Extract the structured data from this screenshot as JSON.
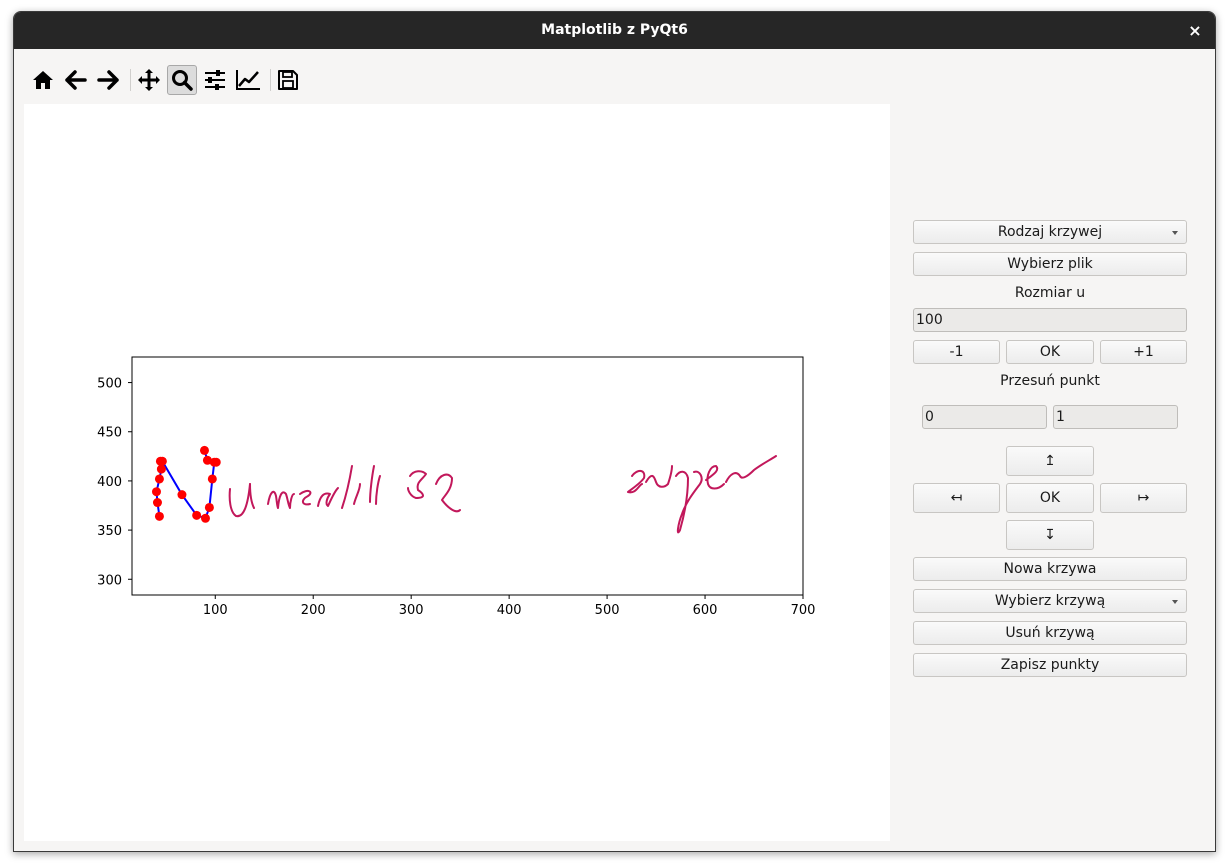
{
  "window": {
    "title": "Matplotlib z PyQt6",
    "close_glyph": "×"
  },
  "toolbar": {
    "items": [
      "home-icon",
      "back-arrow-icon",
      "forward-arrow-icon",
      "pan-icon",
      "zoom-icon",
      "subplots-config-icon",
      "axes-edit-icon",
      "save-icon"
    ],
    "active": "zoom-icon"
  },
  "panel": {
    "curve_type_label": "Rodzaj krzywej",
    "choose_file_label": "Wybierz plik",
    "size_label": "Rozmiar u",
    "size_value": "100",
    "minus_label": "-1",
    "ok_label": "OK",
    "plus_label": "+1",
    "move_point_label": "Przesuń punkt",
    "point_index_value": "0",
    "point_step_value": "1",
    "up_label": "↥",
    "left_label": "↤",
    "ok2_label": "OK",
    "right_label": "↦",
    "down_label": "↧",
    "new_curve_label": "Nowa krzywa",
    "select_curve_label": "Wybierz krzywą",
    "delete_curve_label": "Usuń krzywą",
    "save_points_label": "Zapisz punkty"
  },
  "chart_data": {
    "type": "line",
    "xlim": [
      15,
      700
    ],
    "ylim": [
      284,
      526
    ],
    "xticks": [
      "100",
      "200",
      "300",
      "400",
      "500",
      "600",
      "700"
    ],
    "yticks": [
      "300",
      "350",
      "400",
      "450",
      "500"
    ],
    "xtick_values": [
      100,
      200,
      300,
      400,
      500,
      600,
      700
    ],
    "ytick_values": [
      300,
      350,
      400,
      450,
      500
    ],
    "grid": false,
    "background_image_text": "Numerki są super",
    "series": [
      {
        "color": "#0000ff",
        "marker_color": "#ff0000",
        "x": [
          43,
          41,
          40,
          43,
          45,
          44,
          46,
          66,
          81,
          90,
          94,
          97,
          99,
          101,
          92,
          89
        ],
        "y": [
          364,
          378,
          389,
          402,
          412,
          420,
          420,
          386,
          365,
          362,
          373,
          402,
          419,
          419,
          421,
          431
        ]
      }
    ],
    "ink_color": "#c2185b"
  }
}
